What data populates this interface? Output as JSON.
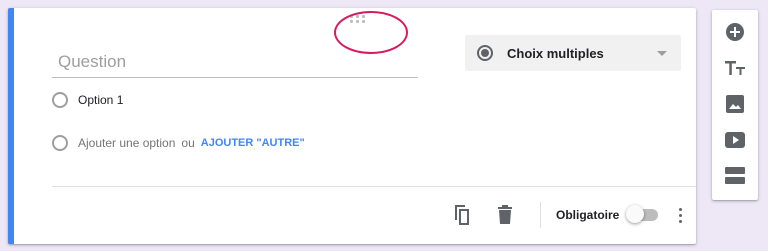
{
  "question": {
    "placeholder": "Question",
    "value": ""
  },
  "type_select": {
    "selected": "Choix multiples",
    "icon": "radio-button-checked-icon"
  },
  "options": [
    {
      "label": "Option 1"
    }
  ],
  "add_option": {
    "label": "Ajouter une option",
    "or": "ou",
    "other_link": "AJOUTER \"AUTRE\""
  },
  "footer": {
    "duplicate_icon": "duplicate-icon",
    "delete_icon": "trash-icon",
    "required_label": "Obligatoire",
    "required_on": false,
    "more_icon": "more-vert-icon"
  },
  "toolbar": {
    "items": [
      {
        "icon": "add-circle-icon"
      },
      {
        "icon": "title-text-icon"
      },
      {
        "icon": "image-icon"
      },
      {
        "icon": "video-icon"
      },
      {
        "icon": "section-icon"
      }
    ]
  },
  "colors": {
    "accent": "#4285f4",
    "highlight": "#d81b60",
    "background": "#ede7f6",
    "icon": "#5f6368"
  }
}
